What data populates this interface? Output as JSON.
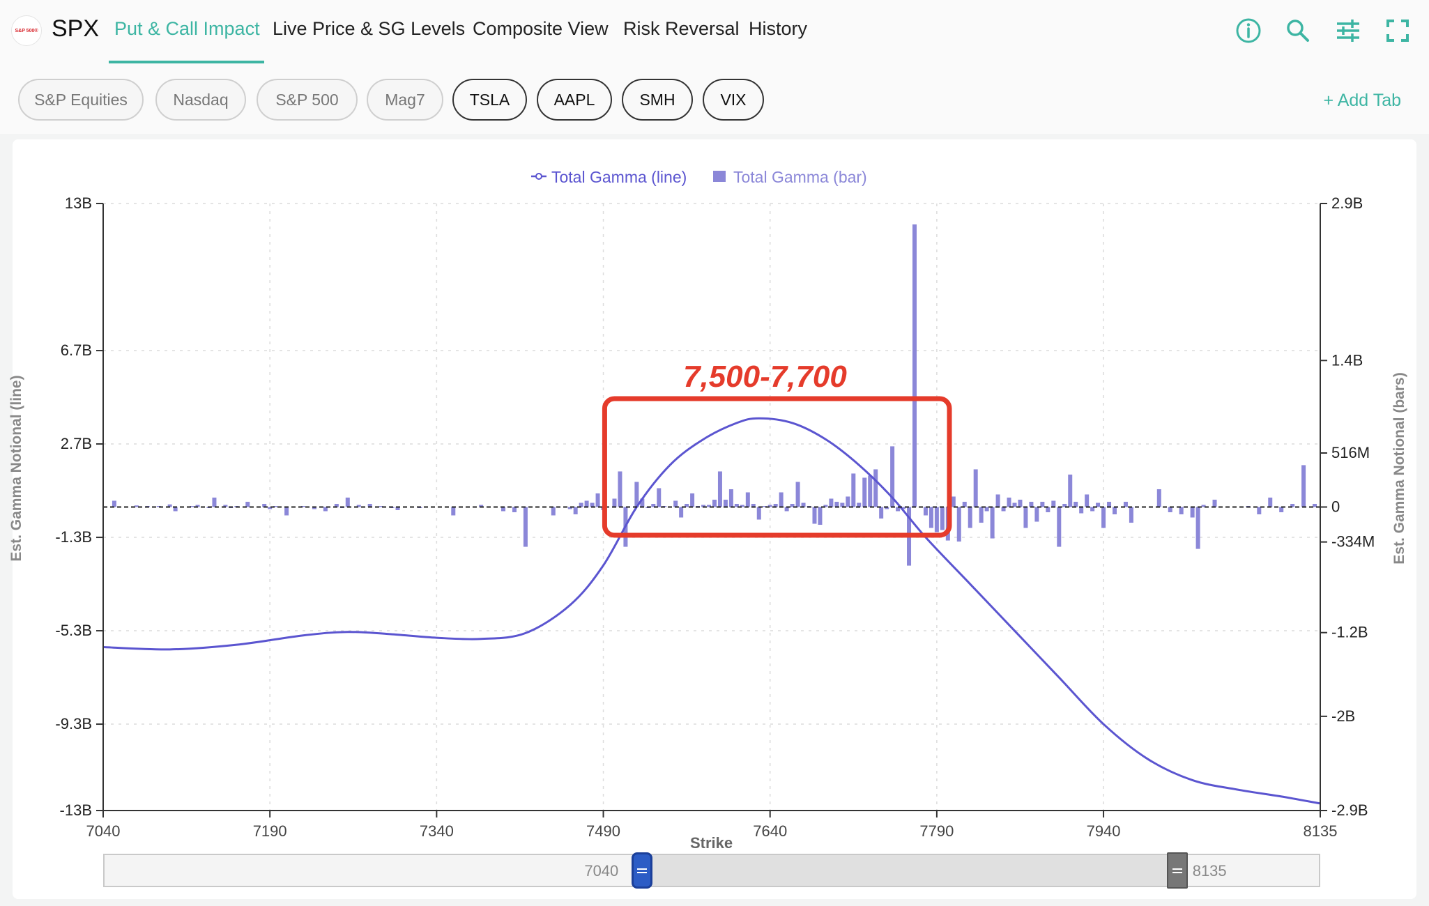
{
  "header": {
    "logo_text": "S&P 500®",
    "ticker": "SPX",
    "nav_tabs": [
      "Put & Call Impact",
      "Live Price & SG Levels",
      "Composite View",
      "Risk Reversal",
      "History"
    ],
    "active_tab": 0,
    "tool_icons": [
      "info-icon",
      "search-icon",
      "sliders-icon",
      "fullscreen-icon"
    ]
  },
  "chips": [
    "S&P Equities",
    "Nasdaq",
    "S&P 500",
    "Mag7",
    "TSLA",
    "AAPL",
    "SMH",
    "VIX"
  ],
  "add_tab_label": "+ Add Tab",
  "annotation": {
    "label": "7,500-7,700",
    "range": [
      7510,
      7770
    ],
    "color": "#e53b2b"
  },
  "slider": {
    "min_label": "7040",
    "max_label": "8135",
    "range_start": 7525,
    "range_end": 8005
  },
  "chart_data": {
    "type": "line+bar",
    "legend": [
      "Total Gamma (line)",
      "Total Gamma (bar)"
    ],
    "legend_position": "top-center",
    "xlabel": "Strike",
    "ylabel_left": "Est. Gamma Notional (line)",
    "ylabel_right": "Est. Gamma Notional (bars)",
    "x_range": [
      7040,
      8135
    ],
    "x_ticks": [
      7040,
      7190,
      7340,
      7490,
      7640,
      7790,
      7940,
      8135
    ],
    "y_left_range": [
      -13,
      13
    ],
    "y_left_ticks": [
      {
        "v": 13,
        "label": "13B"
      },
      {
        "v": 6.7,
        "label": "6.7B"
      },
      {
        "v": 2.7,
        "label": "2.7B"
      },
      {
        "v": -1.3,
        "label": "-1.3B"
      },
      {
        "v": -5.3,
        "label": "-5.3B"
      },
      {
        "v": -9.3,
        "label": "-9.3B"
      },
      {
        "v": -13,
        "label": "-13B"
      }
    ],
    "y_right_range": [
      -2.9,
      2.9
    ],
    "y_right_ticks": [
      {
        "v": 2.9,
        "label": "2.9B"
      },
      {
        "v": 1.4,
        "label": "1.4B"
      },
      {
        "v": 0.516,
        "label": "516M"
      },
      {
        "v": 0,
        "label": "0"
      },
      {
        "v": -0.334,
        "label": "-334M"
      },
      {
        "v": -1.2,
        "label": "-1.2B"
      },
      {
        "v": -2,
        "label": "-2B"
      },
      {
        "v": -2.9,
        "label": "-2.9B"
      }
    ],
    "grid": true,
    "line_color": "#5b55d0",
    "bar_color": "#8b87d8",
    "line_points": [
      [
        7040,
        -6.0
      ],
      [
        7100,
        -6.1
      ],
      [
        7160,
        -5.9
      ],
      [
        7220,
        -5.5
      ],
      [
        7260,
        -5.35
      ],
      [
        7300,
        -5.45
      ],
      [
        7340,
        -5.6
      ],
      [
        7380,
        -5.65
      ],
      [
        7420,
        -5.4
      ],
      [
        7460,
        -4.2
      ],
      [
        7490,
        -2.5
      ],
      [
        7520,
        0.0
      ],
      [
        7550,
        1.8
      ],
      [
        7580,
        2.9
      ],
      [
        7610,
        3.6
      ],
      [
        7630,
        3.8
      ],
      [
        7660,
        3.6
      ],
      [
        7690,
        2.9
      ],
      [
        7720,
        1.8
      ],
      [
        7750,
        0.4
      ],
      [
        7780,
        -1.3
      ],
      [
        7820,
        -3.3
      ],
      [
        7860,
        -5.3
      ],
      [
        7900,
        -7.3
      ],
      [
        7940,
        -9.3
      ],
      [
        7980,
        -10.8
      ],
      [
        8020,
        -11.7
      ],
      [
        8060,
        -12.1
      ],
      [
        8100,
        -12.4
      ],
      [
        8135,
        -12.7
      ]
    ],
    "bars": [
      [
        7050,
        0.06
      ],
      [
        7070,
        0.015
      ],
      [
        7080,
        0.01
      ],
      [
        7090,
        0.01
      ],
      [
        7100,
        0.025
      ],
      [
        7105,
        -0.04
      ],
      [
        7125,
        0.02
      ],
      [
        7135,
        -0.01
      ],
      [
        7120,
        0.01
      ],
      [
        7140,
        0.09
      ],
      [
        7150,
        0.02
      ],
      [
        7155,
        -0.01
      ],
      [
        7160,
        0.01
      ],
      [
        7170,
        0.05
      ],
      [
        7185,
        0.03
      ],
      [
        7190,
        -0.02
      ],
      [
        7195,
        0.01
      ],
      [
        7205,
        -0.08
      ],
      [
        7220,
        0.01
      ],
      [
        7230,
        -0.02
      ],
      [
        7240,
        -0.04
      ],
      [
        7250,
        0.03
      ],
      [
        7255,
        -0.01
      ],
      [
        7260,
        0.09
      ],
      [
        7270,
        0.02
      ],
      [
        7280,
        0.03
      ],
      [
        7290,
        0.01
      ],
      [
        7300,
        -0.01
      ],
      [
        7305,
        -0.03
      ],
      [
        7325,
        -0.01
      ],
      [
        7355,
        -0.08
      ],
      [
        7380,
        0.02
      ],
      [
        7400,
        -0.04
      ],
      [
        7410,
        -0.05
      ],
      [
        7420,
        -0.38
      ],
      [
        7445,
        -0.08
      ],
      [
        7460,
        -0.02
      ],
      [
        7465,
        -0.07
      ],
      [
        7470,
        0.04
      ],
      [
        7475,
        0.06
      ],
      [
        7480,
        0.04
      ],
      [
        7485,
        0.13
      ],
      [
        7490,
        -0.03
      ],
      [
        7500,
        0.08
      ],
      [
        7505,
        0.34
      ],
      [
        7510,
        -0.38
      ],
      [
        7520,
        0.24
      ],
      [
        7525,
        0.08
      ],
      [
        7530,
        -0.01
      ],
      [
        7535,
        0.03
      ],
      [
        7540,
        0.18
      ],
      [
        7545,
        0.01
      ],
      [
        7555,
        0.06
      ],
      [
        7560,
        -0.1
      ],
      [
        7565,
        0.03
      ],
      [
        7570,
        0.13
      ],
      [
        7575,
        0.01
      ],
      [
        7580,
        0.02
      ],
      [
        7585,
        0.02
      ],
      [
        7590,
        0.07
      ],
      [
        7595,
        0.34
      ],
      [
        7600,
        0.07
      ],
      [
        7605,
        0.17
      ],
      [
        7610,
        0.03
      ],
      [
        7615,
        0.02
      ],
      [
        7620,
        0.14
      ],
      [
        7625,
        0.03
      ],
      [
        7630,
        -0.12
      ],
      [
        7635,
        0.01
      ],
      [
        7640,
        0.02
      ],
      [
        7645,
        0.03
      ],
      [
        7650,
        0.14
      ],
      [
        7655,
        -0.04
      ],
      [
        7660,
        0.03
      ],
      [
        7665,
        0.24
      ],
      [
        7670,
        0.04
      ],
      [
        7675,
        0.01
      ],
      [
        7680,
        -0.16
      ],
      [
        7685,
        -0.17
      ],
      [
        7690,
        0.02
      ],
      [
        7695,
        0.08
      ],
      [
        7700,
        0.05
      ],
      [
        7705,
        0.04
      ],
      [
        7710,
        0.1
      ],
      [
        7715,
        0.32
      ],
      [
        7720,
        0.04
      ],
      [
        7725,
        0.28
      ],
      [
        7730,
        0.3
      ],
      [
        7735,
        0.36
      ],
      [
        7740,
        -0.11
      ],
      [
        7745,
        -0.02
      ],
      [
        7750,
        0.58
      ],
      [
        7755,
        -0.04
      ],
      [
        7760,
        -0.02
      ],
      [
        7765,
        -0.56
      ],
      [
        7770,
        2.7
      ],
      [
        7780,
        -0.08
      ],
      [
        7785,
        -0.2
      ],
      [
        7790,
        -0.24
      ],
      [
        7795,
        -0.22
      ],
      [
        7800,
        -0.32
      ],
      [
        7805,
        0.1
      ],
      [
        7810,
        -0.33
      ],
      [
        7815,
        0.05
      ],
      [
        7820,
        -0.2
      ],
      [
        7825,
        0.36
      ],
      [
        7830,
        -0.15
      ],
      [
        7835,
        -0.04
      ],
      [
        7840,
        -0.3
      ],
      [
        7845,
        0.12
      ],
      [
        7850,
        -0.04
      ],
      [
        7855,
        0.09
      ],
      [
        7860,
        0.04
      ],
      [
        7865,
        0.07
      ],
      [
        7870,
        -0.2
      ],
      [
        7875,
        0.05
      ],
      [
        7880,
        -0.14
      ],
      [
        7885,
        0.05
      ],
      [
        7890,
        -0.05
      ],
      [
        7895,
        0.06
      ],
      [
        7900,
        -0.38
      ],
      [
        7905,
        0.03
      ],
      [
        7910,
        0.31
      ],
      [
        7915,
        0.05
      ],
      [
        7920,
        -0.06
      ],
      [
        7925,
        0.12
      ],
      [
        7930,
        -0.04
      ],
      [
        7935,
        0.04
      ],
      [
        7940,
        -0.2
      ],
      [
        7945,
        0.05
      ],
      [
        7950,
        -0.07
      ],
      [
        7960,
        0.05
      ],
      [
        7965,
        -0.15
      ],
      [
        7990,
        0.17
      ],
      [
        8000,
        -0.05
      ],
      [
        8010,
        -0.07
      ],
      [
        8020,
        -0.1
      ],
      [
        8025,
        -0.4
      ],
      [
        8030,
        0.02
      ],
      [
        8040,
        0.07
      ],
      [
        8070,
        0.01
      ],
      [
        8080,
        -0.07
      ],
      [
        8090,
        0.09
      ],
      [
        8100,
        -0.05
      ],
      [
        8110,
        0.03
      ],
      [
        8120,
        0.4
      ],
      [
        8130,
        0.03
      ]
    ]
  }
}
